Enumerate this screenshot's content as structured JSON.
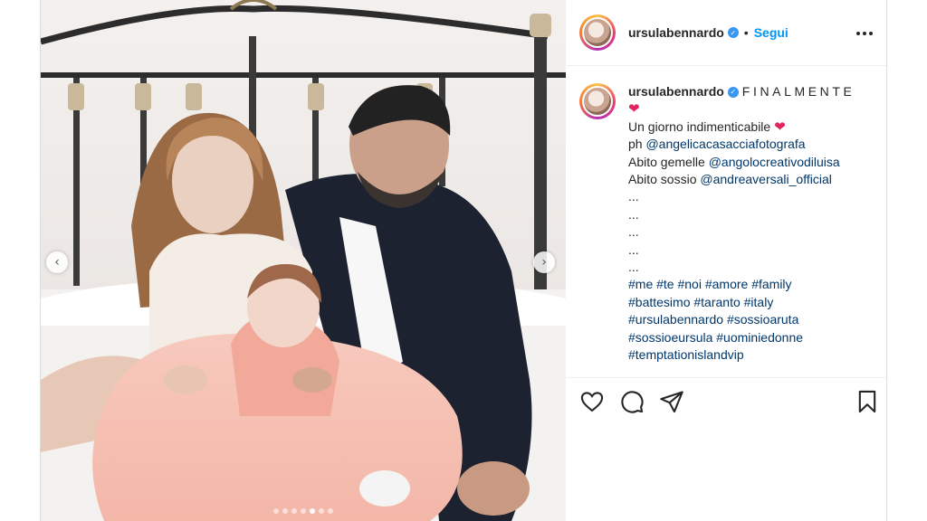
{
  "post": {
    "username": "ursulabennardo",
    "verified_mark": "✓",
    "separator": "•",
    "follow_label": "Segui",
    "more_label": "•••"
  },
  "media": {
    "prev_arrow": "‹",
    "next_arrow": "›",
    "carousel_dot_count": 7,
    "carousel_active_index": 4
  },
  "caption": {
    "username": "ursulabennardo",
    "first_word": "FINALMENTE",
    "heart": "❤",
    "line1": "Un giorno indimenticabile",
    "line2_prefix": "ph ",
    "line2_link": "@angelicacasacciafotografa",
    "line3_prefix": "Abito gemelle ",
    "line3_link": "@angolocreativodiluisa",
    "line4_prefix": "Abito sossio ",
    "line4_link": "@andreaversali_official",
    "ellipsis_lines": [
      "...",
      "...",
      "...",
      "...",
      "..."
    ],
    "hashtag_lines": [
      "#me #te #noi #amore #family",
      "#battesimo #taranto #italy",
      "#ursulabennardo #sossioaruta",
      "#sossioeursula #uominiedonne",
      "#temptationislandvip"
    ]
  },
  "actions": {
    "like_icon": "heart-outline",
    "comment_icon": "speech-bubble",
    "share_icon": "paper-plane",
    "save_icon": "bookmark"
  },
  "colors": {
    "link": "#00376b",
    "follow": "#0095f6",
    "verified": "#3897f0",
    "heart": "#e0245e"
  }
}
